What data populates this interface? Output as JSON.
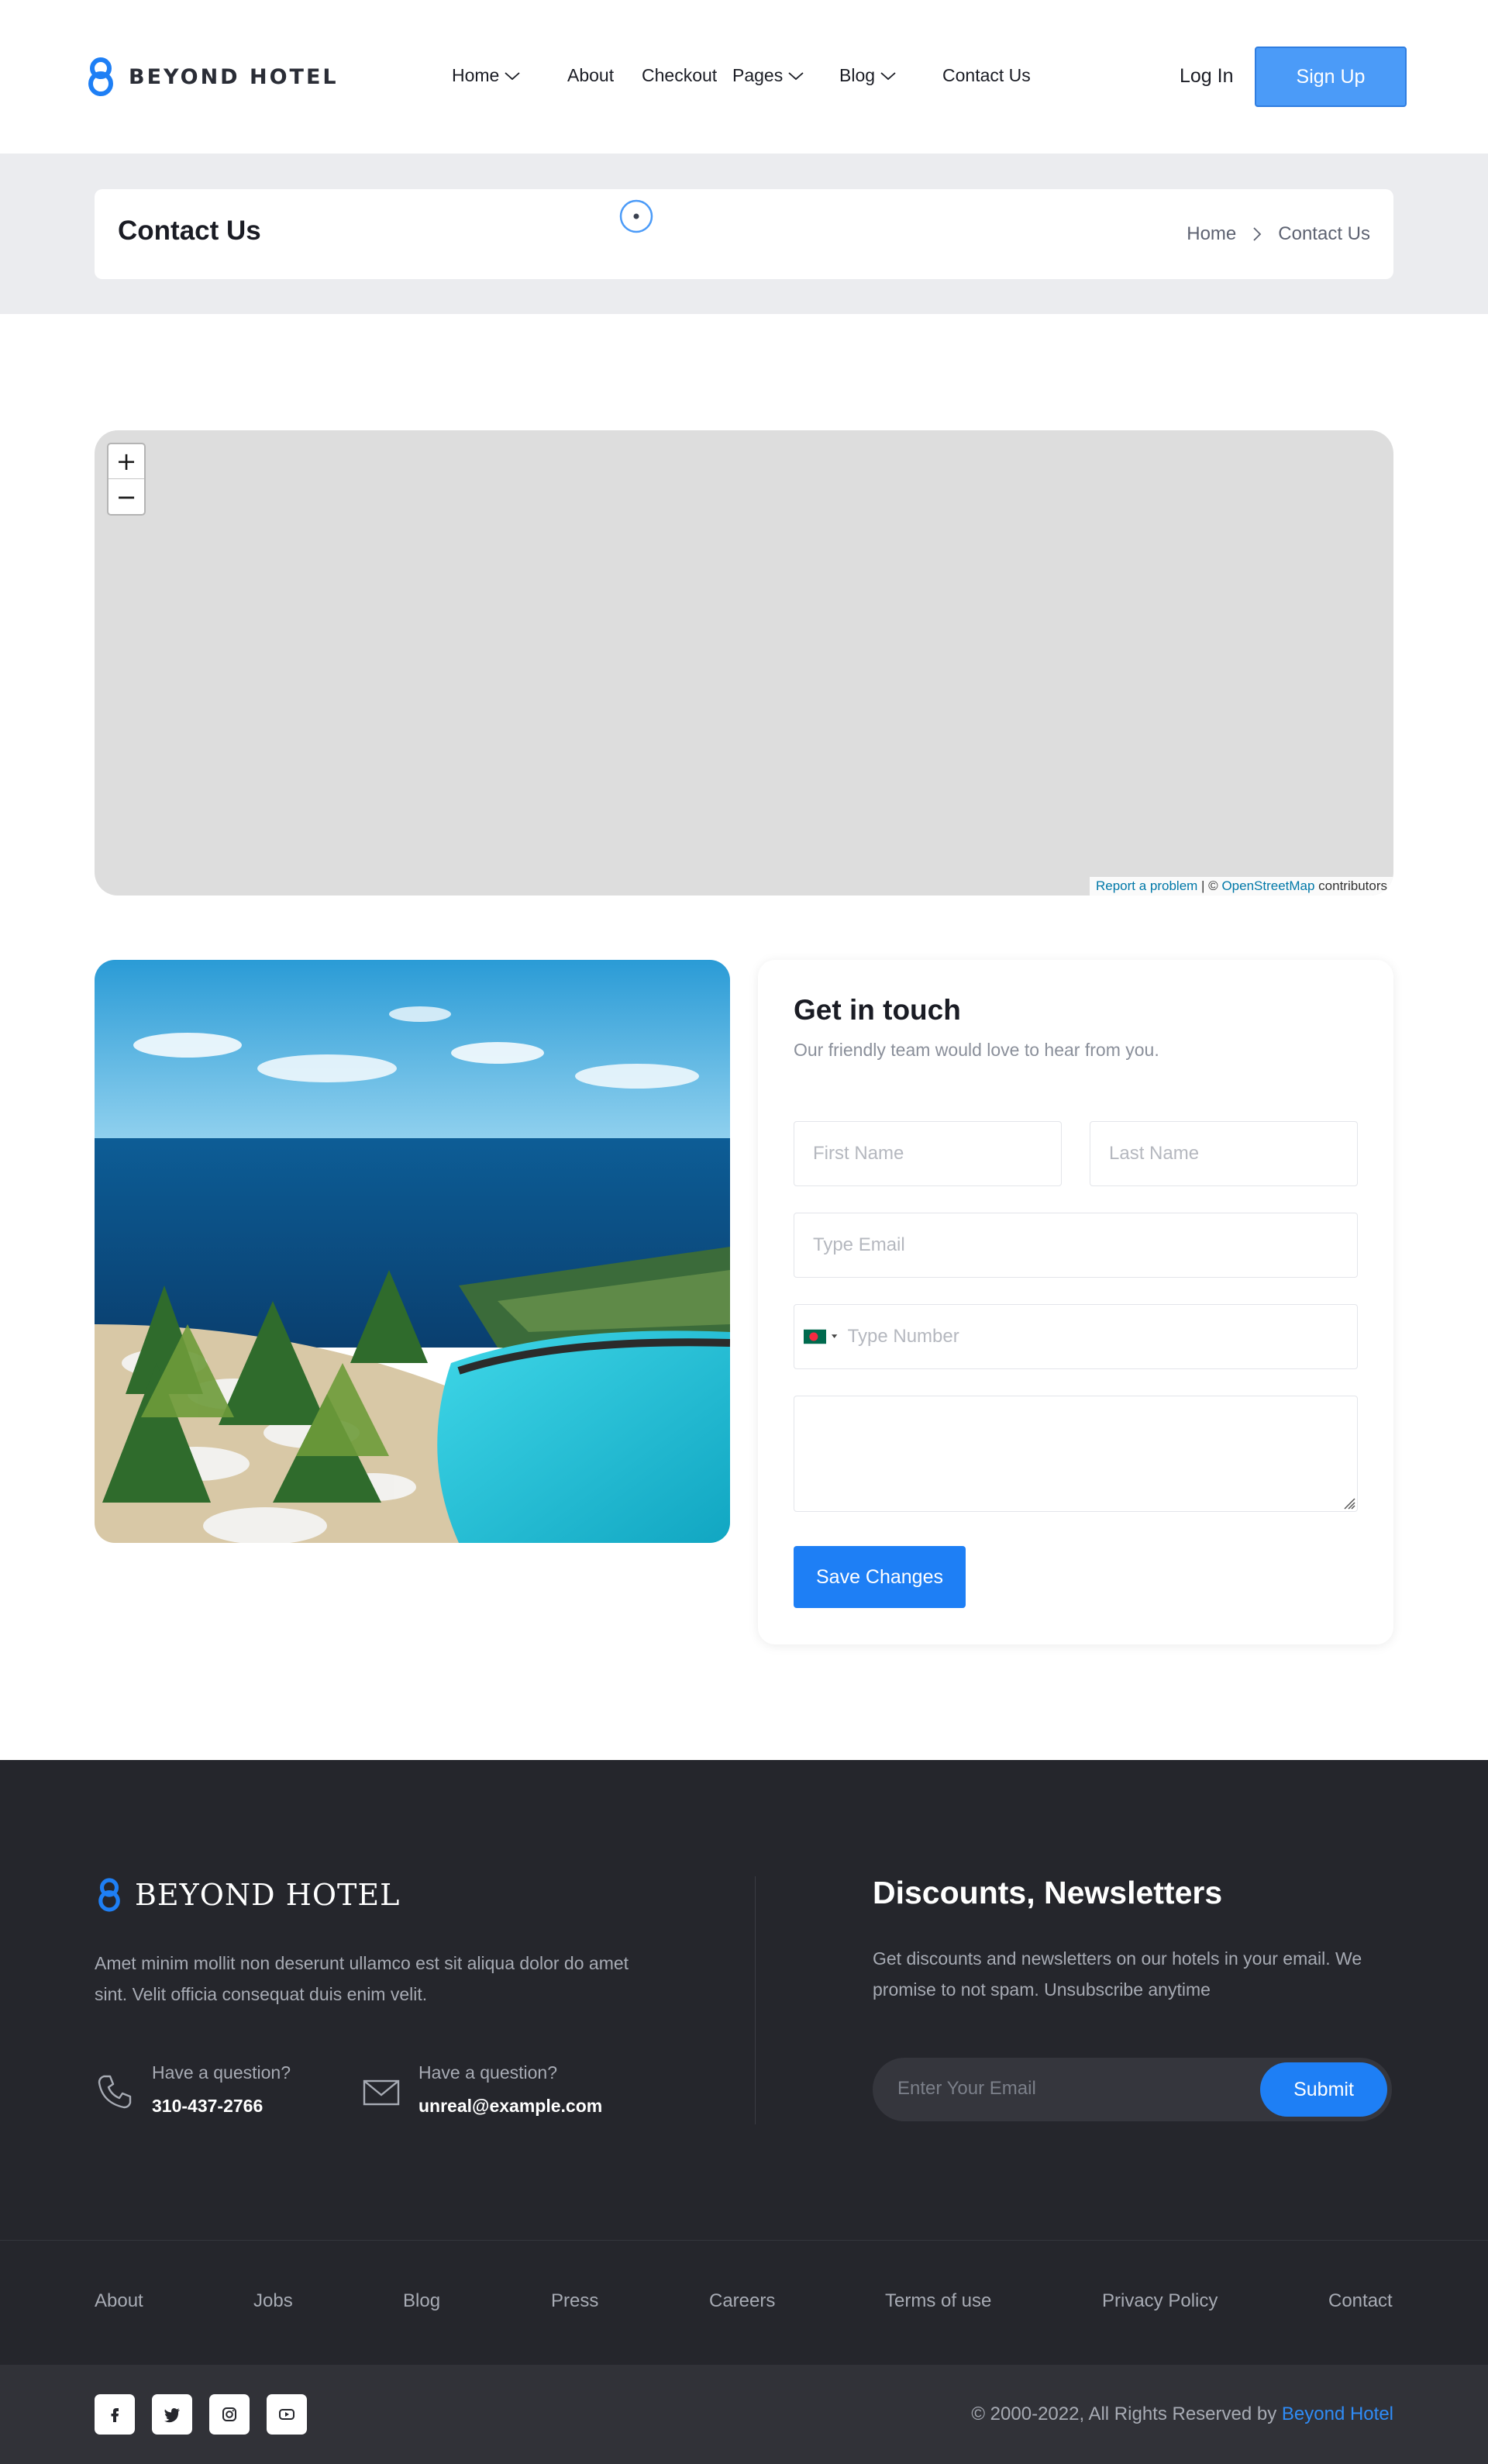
{
  "header": {
    "brand": "BEYOND HOTEL",
    "nav": [
      {
        "label": "Home",
        "dropdown": true
      },
      {
        "label": "About",
        "dropdown": false
      },
      {
        "label": "Checkout",
        "dropdown": false
      },
      {
        "label": "Pages",
        "dropdown": true
      },
      {
        "label": "Blog",
        "dropdown": true
      },
      {
        "label": "Contact Us",
        "dropdown": false
      }
    ],
    "login": "Log In",
    "signup": "Sign Up"
  },
  "breadcrumb": {
    "title": "Contact Us",
    "trail": [
      "Home",
      "Contact Us"
    ]
  },
  "map": {
    "zoom_in": "+",
    "zoom_out": "−",
    "report": "Report a problem",
    "separator": " | © ",
    "osm": "OpenStreetMap",
    "contributors": " contributors"
  },
  "form": {
    "title": "Get in touch",
    "subtitle": "Our friendly team would love to hear from you.",
    "first_name_placeholder": "First Name",
    "last_name_placeholder": "Last Name",
    "email_placeholder": "Type Email",
    "phone_placeholder": "Type Number",
    "submit": "Save Changes"
  },
  "footer": {
    "brand": "BEYOND HOTEL",
    "description": "Amet minim mollit non deserunt ullamco est sit aliqua dolor do amet sint. Velit officia consequat duis enim velit.",
    "phone_label": "Have a question?",
    "phone": "310-437-2766",
    "email_label": "Have a question?",
    "email": "unreal@example.com",
    "newsletter_title": "Discounts, Newsletters",
    "newsletter_desc": "Get discounts and newsletters on our hotels in your email. We promise to not spam. Unsubscribe anytime",
    "newsletter_placeholder": "Enter Your Email",
    "newsletter_button": "Submit",
    "links": [
      "About",
      "Jobs",
      "Blog",
      "Press",
      "Careers",
      "Terms of use",
      "Privacy Policy",
      "Contact"
    ],
    "social": [
      "facebook-icon",
      "twitter-icon",
      "instagram-icon",
      "youtube-icon"
    ],
    "copyright": "© 2000-2022, All Rights Reserved by ",
    "copyright_brand": "Beyond Hotel"
  },
  "colors": {
    "accent": "#1e7ff5",
    "footer_bg": "#25262c",
    "band_bg": "#ebecef"
  }
}
